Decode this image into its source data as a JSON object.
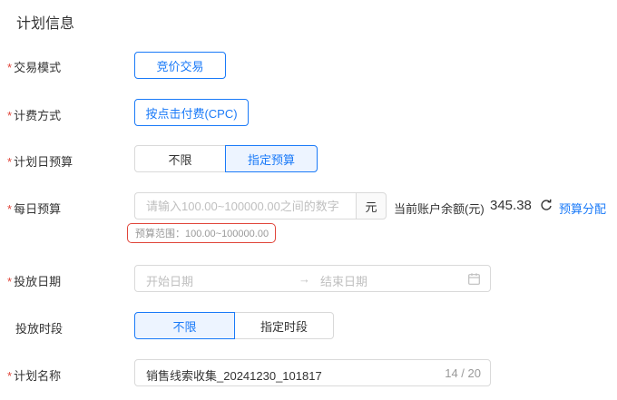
{
  "section": {
    "title": "计划信息"
  },
  "required_mark": "*",
  "trade_mode": {
    "label": "交易模式",
    "value": "竞价交易"
  },
  "billing": {
    "label": "计费方式",
    "value": "按点击付费(CPC)"
  },
  "daily_plan_budget": {
    "label": "计划日预算",
    "options": [
      "不限",
      "指定预算"
    ],
    "selected": "指定预算"
  },
  "daily_budget": {
    "label": "每日预算",
    "placeholder": "请输入100.00~100000.00之间的数字",
    "unit": "元",
    "balance_label": "当前账户余额(元)",
    "balance_value": "345.38",
    "refresh_icon": "refresh-icon",
    "alloc_link": "预算分配",
    "hint": "预算范围：100.00~100000.00"
  },
  "delivery_date": {
    "label": "投放日期",
    "start_placeholder": "开始日期",
    "arrow": "→",
    "end_placeholder": "结束日期",
    "icon": "calendar-icon"
  },
  "delivery_time": {
    "label": "投放时段",
    "options": [
      "不限",
      "指定时段"
    ],
    "selected": "不限"
  },
  "plan_name": {
    "label": "计划名称",
    "value": "销售线索收集_20241230_101817",
    "counter": "14 / 20"
  },
  "colors": {
    "primary": "#1a7af8",
    "required": "#e0453a",
    "hint_border": "#e0453a"
  }
}
